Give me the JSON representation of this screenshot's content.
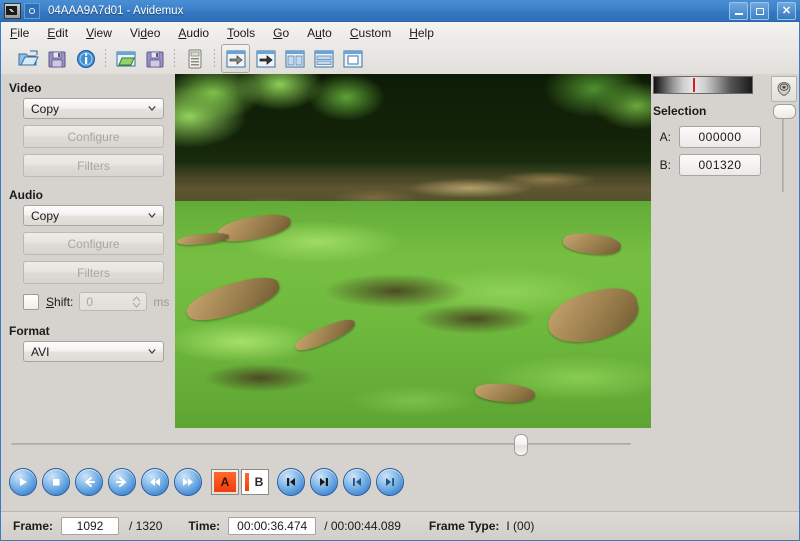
{
  "window": {
    "title": "04AAA9A7d01 - Avidemux",
    "app_icon": "avidemux-icon",
    "menu_icon": "window-menu-icon",
    "buttons": {
      "minimize": "minimize-button",
      "maximize": "maximize-button",
      "close_label": "✕"
    }
  },
  "menubar": {
    "items": [
      {
        "label": "File",
        "mnemonic": "F"
      },
      {
        "label": "Edit",
        "mnemonic": "E"
      },
      {
        "label": "View",
        "mnemonic": "V"
      },
      {
        "label": "Video",
        "mnemonic": "d"
      },
      {
        "label": "Audio",
        "mnemonic": "A"
      },
      {
        "label": "Tools",
        "mnemonic": "T"
      },
      {
        "label": "Go",
        "mnemonic": "G"
      },
      {
        "label": "Auto",
        "mnemonic": "u"
      },
      {
        "label": "Custom",
        "mnemonic": "C"
      },
      {
        "label": "Help",
        "mnemonic": "H"
      }
    ]
  },
  "toolbar": {
    "items": [
      {
        "name": "open-file-icon",
        "title": "Open"
      },
      {
        "name": "save-file-icon",
        "title": "Save"
      },
      {
        "name": "info-icon",
        "title": "Properties"
      },
      {
        "name": "open-project-icon",
        "title": "Open Project"
      },
      {
        "name": "save-project-icon",
        "title": "Save Project"
      },
      {
        "name": "calculator-icon",
        "title": "Calculator"
      },
      {
        "name": "append-icon",
        "title": "Append"
      },
      {
        "name": "export-icon",
        "title": "Export"
      },
      {
        "name": "split-vertical-icon",
        "title": "Split Vertical"
      },
      {
        "name": "split-horizontal-icon",
        "title": "Split Horizontal"
      },
      {
        "name": "single-view-icon",
        "title": "Single View"
      }
    ]
  },
  "sidebar": {
    "video": {
      "title": "Video",
      "codec": "Copy",
      "configure_label": "Configure",
      "filters_label": "Filters"
    },
    "audio": {
      "title": "Audio",
      "codec": "Copy",
      "configure_label": "Configure",
      "filters_label": "Filters",
      "shift_label": "Shift:",
      "shift_value": "0",
      "shift_unit": "ms"
    },
    "format": {
      "title": "Format",
      "container": "AVI"
    }
  },
  "preview": {
    "description": "video-preview-frame"
  },
  "transport": {
    "seek_percent": 82.7,
    "buttons": [
      {
        "name": "play-button",
        "glyph": "play"
      },
      {
        "name": "stop-button",
        "glyph": "stop"
      },
      {
        "name": "previous-frame-button",
        "glyph": "left"
      },
      {
        "name": "next-frame-button",
        "glyph": "right"
      },
      {
        "name": "rewind-button",
        "glyph": "rewind"
      },
      {
        "name": "forward-button",
        "glyph": "forward"
      }
    ],
    "marker_a_label": "A",
    "marker_b_label": "B",
    "nav_buttons": [
      {
        "name": "previous-keyframe-button",
        "glyph": "skip-prev"
      },
      {
        "name": "next-keyframe-button",
        "glyph": "skip-next"
      },
      {
        "name": "go-to-start-button",
        "glyph": "first"
      },
      {
        "name": "go-to-end-button",
        "glyph": "last"
      }
    ]
  },
  "selection": {
    "meter_position_percent": 40,
    "title": "Selection",
    "a_label": "A:",
    "a_value": "000000",
    "b_label": "B:",
    "b_value": "001320",
    "volume_icon": "volume-icon",
    "volume_level_percent": 96
  },
  "statusbar": {
    "frame_label": "Frame:",
    "frame_value": "1092",
    "frame_total": "/ 1320",
    "time_label": "Time:",
    "time_value": "00:00:36.474",
    "time_total": "/ 00:00:44.089",
    "frame_type_label": "Frame Type:",
    "frame_type_value": "I (00)"
  },
  "colors": {
    "titlebar": "#3578c2",
    "window_bg": "#d6d2ce",
    "accent_orange": "#ef3c10",
    "meter_needle": "#d81b1b"
  }
}
